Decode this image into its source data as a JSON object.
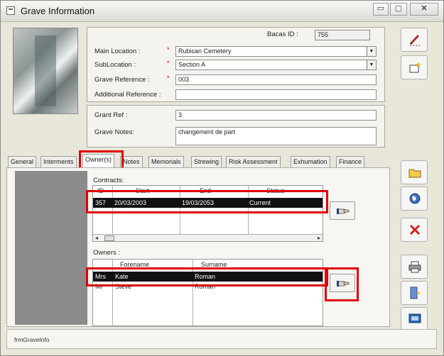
{
  "window": {
    "title": "Grave Information",
    "min_glyph": "▭",
    "max_glyph": "▢",
    "close_glyph": "✕"
  },
  "header": {
    "bacas_id_label": "Bacas ID :",
    "bacas_id_value": "755",
    "main_location_label": "Main Location :",
    "main_location_value": "Rubican Cemetery",
    "sublocation_label": "SubLocation :",
    "sublocation_value": "Section A",
    "grave_reference_label": "Grave Reference :",
    "grave_reference_value": "003",
    "additional_reference_label": "Additional Reference :",
    "additional_reference_value": "",
    "required_marker": "*"
  },
  "details": {
    "grant_ref_label": "Grant Ref :",
    "grant_ref_value": "3",
    "grave_notes_label": "Grave Notes:",
    "grave_notes_value": "changement de part"
  },
  "tabs": [
    {
      "label": "General"
    },
    {
      "label": "Interments"
    },
    {
      "label": "Owner(s)"
    },
    {
      "label": "Notes"
    },
    {
      "label": "Memorials"
    },
    {
      "label": "Strewing"
    },
    {
      "label": "Risk Assessment"
    },
    {
      "label": "Exhumation"
    },
    {
      "label": "Finance"
    }
  ],
  "contracts": {
    "label": "Contracts:",
    "columns": [
      "ID",
      "Start",
      "End",
      "Status"
    ],
    "rows": [
      {
        "id": "357",
        "start": "20/03/2003",
        "end": "19/03/2053",
        "status": "Current"
      }
    ]
  },
  "owners": {
    "label": "Owners :",
    "columns": [
      "Forename",
      "Surname"
    ],
    "rows": [
      {
        "title": "Mrs",
        "forename": "Kate",
        "surname": "Roman"
      },
      {
        "title": "Mr",
        "forename": "Steve",
        "surname": "Roman"
      }
    ]
  },
  "scroll": {
    "left": "◂",
    "right": "▸"
  },
  "combo_arrow": "▼",
  "status_bar": {
    "form_name": "frmGraveInfo"
  },
  "toolbar_icons": [
    "edit-pencil-icon",
    "new-record-icon",
    "open-folder-icon",
    "globe-icon",
    "delete-x-icon",
    "print-icon",
    "exit-door-icon",
    "screen-icon"
  ],
  "colors": {
    "highlight": "#e00000",
    "selected_row": "#111111",
    "window_bg": "#e9e6da"
  }
}
